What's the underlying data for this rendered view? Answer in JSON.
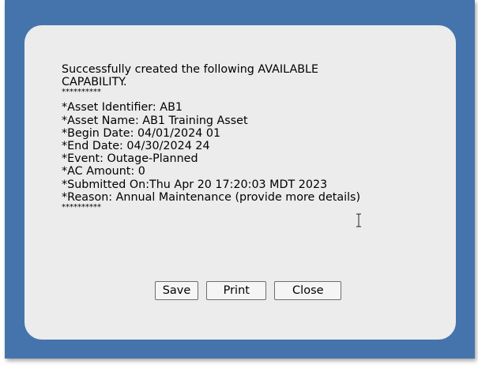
{
  "dialog": {
    "heading": "Successfully created the following AVAILABLE CAPABILITY.",
    "separator_top": "**********",
    "fields": [
      "*Asset Identifier: AB1",
      "*Asset Name: AB1 Training Asset",
      "*Begin Date: 04/01/2024 01",
      "*End Date: 04/30/2024 24",
      "*Event: Outage-Planned",
      "*AC Amount: 0",
      "*Submitted On:Thu Apr 20 17:20:03 MDT 2023",
      "*Reason: Annual Maintenance (provide more details)"
    ],
    "separator_bottom": "**********"
  },
  "buttons": {
    "save_label": "Save",
    "print_label": "Print",
    "close_label": "Close"
  },
  "colors": {
    "frame": "#4574ad",
    "dialog_bg": "#ececec"
  },
  "cursor": {
    "icon": "text-cursor-icon"
  }
}
